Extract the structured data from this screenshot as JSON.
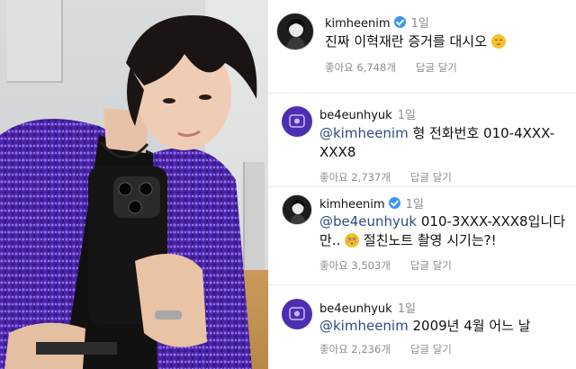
{
  "comments": [
    {
      "username": "kimheenim",
      "verified": true,
      "time": "1일",
      "text_line1": "진짜 이혁재란 증거를 대시오",
      "emoji": "pensive-face",
      "likes": "좋아요 6,748개",
      "reply": "답글 달기"
    },
    {
      "username": "be4eunhyuk",
      "verified": false,
      "time": "1일",
      "mention": "@kimheenim",
      "text_line1": " 형 전화번호 010-4XXX-",
      "text_line2": "XXX8",
      "likes": "좋아요 2,737개",
      "reply": "답글 달기"
    },
    {
      "username": "kimheenim",
      "verified": true,
      "time": "1일",
      "mention": "@be4eunhyuk",
      "text_line1": " 010-3XXX-XXX8입니다",
      "text_line2a": "만..",
      "emoji": "flushed-face",
      "text_line2b": " 절친노트 촬영 시기는?!",
      "likes": "좋아요 3,503개",
      "reply": "답글 달기"
    },
    {
      "username": "be4eunhyuk",
      "verified": false,
      "time": "1일",
      "mention": "@kimheenim",
      "text_line1": " 2009년 4월 어느 날",
      "likes": "좋아요 2,236개",
      "reply": "답글 달기"
    }
  ],
  "colors": {
    "mention": "#2b4c85",
    "meta": "#8e8e8e",
    "verified": "#3897f0",
    "avatar_purple": "#4e2eb0",
    "jacket_purple": "#5a2bb8"
  }
}
